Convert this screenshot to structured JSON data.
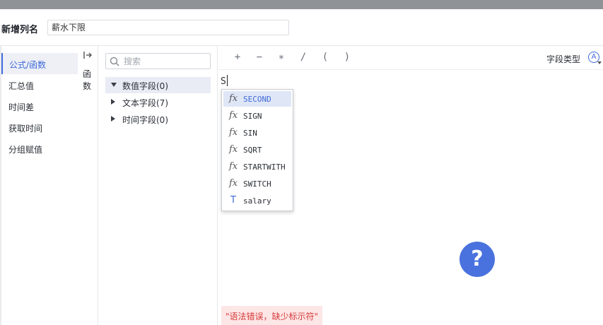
{
  "header": {
    "name_label": "新增列名",
    "name_value": "薪水下限"
  },
  "left_nav": {
    "items": [
      {
        "label": "公式/函数",
        "active": true
      },
      {
        "label": "汇总值",
        "active": false
      },
      {
        "label": "时间差",
        "active": false
      },
      {
        "label": "获取时间",
        "active": false
      },
      {
        "label": "分组赋值",
        "active": false
      }
    ]
  },
  "func_strip": {
    "label": "函数"
  },
  "field_panel": {
    "search_placeholder": "搜索",
    "tree": [
      {
        "label": "数值字段(0)",
        "expanded": true,
        "selected": true
      },
      {
        "label": "文本字段(7)",
        "expanded": false,
        "selected": false
      },
      {
        "label": "时间字段(0)",
        "expanded": false,
        "selected": false
      }
    ]
  },
  "editor": {
    "operators": [
      "+",
      "−",
      "∗",
      "/",
      "(",
      ")"
    ],
    "field_type_label": "字段类型",
    "field_type_icon": "Ⓐ",
    "code": "S",
    "suggestions": [
      {
        "icon": "fx",
        "label": "SECOND",
        "active": true
      },
      {
        "icon": "fx",
        "label": "SIGN",
        "active": false
      },
      {
        "icon": "fx",
        "label": "SIN",
        "active": false
      },
      {
        "icon": "fx",
        "label": "SQRT",
        "active": false
      },
      {
        "icon": "fx",
        "label": "STARTWITH",
        "active": false
      },
      {
        "icon": "fx",
        "label": "SWITCH",
        "active": false
      },
      {
        "icon": "T",
        "label": "salary",
        "active": false
      }
    ],
    "error": "\"语法错误，缺少标示符\"",
    "help_glyph": "?"
  },
  "colors": {
    "accent": "#3f6ad8",
    "help_button": "#4a72de",
    "error_text": "#d63b3b",
    "error_bg": "#fde6e6",
    "topbar": "#8f9297"
  }
}
